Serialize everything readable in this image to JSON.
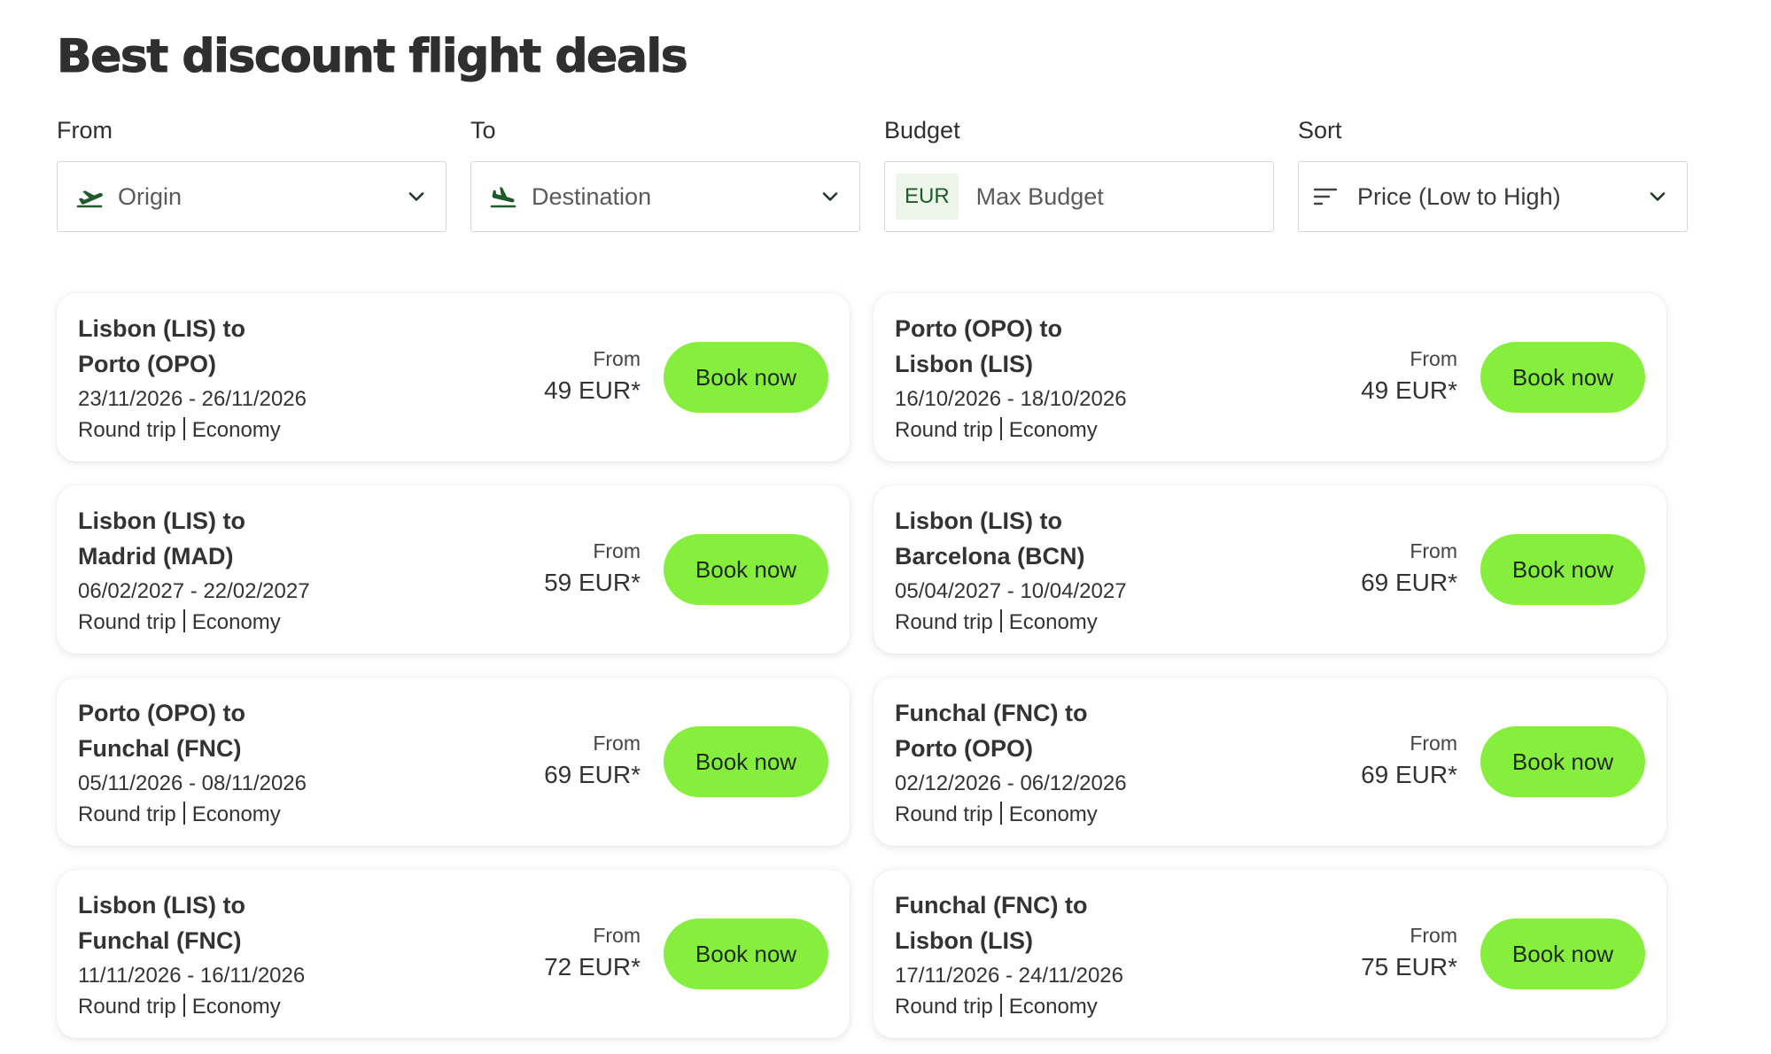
{
  "page": {
    "title": "Best discount flight deals"
  },
  "filters": {
    "from": {
      "label": "From",
      "placeholder": "Origin",
      "icon": "plane-takeoff-icon"
    },
    "to": {
      "label": "To",
      "placeholder": "Destination",
      "icon": "plane-landing-icon"
    },
    "budget": {
      "label": "Budget",
      "currency": "EUR",
      "placeholder": "Max Budget"
    },
    "sort": {
      "label": "Sort",
      "value": "Price (Low to High)",
      "icon": "sort-lines-icon"
    }
  },
  "colors": {
    "accent_green": "#86ef3e",
    "icon_dark_green": "#1e5a2a"
  },
  "deals": [
    {
      "route_line1": "Lisbon (LIS) to",
      "route_line2": "Porto (OPO)",
      "dates": "23/11/2026 - 26/11/2026",
      "trip_type": "Round trip",
      "cabin": "Economy",
      "price_from": "From",
      "price": "49 EUR*",
      "button": "Book now"
    },
    {
      "route_line1": "Porto (OPO) to",
      "route_line2": "Lisbon (LIS)",
      "dates": "16/10/2026 - 18/10/2026",
      "trip_type": "Round trip",
      "cabin": "Economy",
      "price_from": "From",
      "price": "49 EUR*",
      "button": "Book now"
    },
    {
      "route_line1": "Lisbon (LIS) to",
      "route_line2": "Madrid (MAD)",
      "dates": "06/02/2027 - 22/02/2027",
      "trip_type": "Round trip",
      "cabin": "Economy",
      "price_from": "From",
      "price": "59 EUR*",
      "button": "Book now"
    },
    {
      "route_line1": "Lisbon (LIS) to",
      "route_line2": "Barcelona (BCN)",
      "dates": "05/04/2027 - 10/04/2027",
      "trip_type": "Round trip",
      "cabin": "Economy",
      "price_from": "From",
      "price": "69 EUR*",
      "button": "Book now"
    },
    {
      "route_line1": "Porto (OPO) to",
      "route_line2": "Funchal (FNC)",
      "dates": "05/11/2026 - 08/11/2026",
      "trip_type": "Round trip",
      "cabin": "Economy",
      "price_from": "From",
      "price": "69 EUR*",
      "button": "Book now"
    },
    {
      "route_line1": "Funchal (FNC) to",
      "route_line2": "Porto (OPO)",
      "dates": "02/12/2026 - 06/12/2026",
      "trip_type": "Round trip",
      "cabin": "Economy",
      "price_from": "From",
      "price": "69 EUR*",
      "button": "Book now"
    },
    {
      "route_line1": "Lisbon (LIS) to",
      "route_line2": "Funchal (FNC)",
      "dates": "11/11/2026 - 16/11/2026",
      "trip_type": "Round trip",
      "cabin": "Economy",
      "price_from": "From",
      "price": "72 EUR*",
      "button": "Book now"
    },
    {
      "route_line1": "Funchal (FNC) to",
      "route_line2": "Lisbon (LIS)",
      "dates": "17/11/2026 - 24/11/2026",
      "trip_type": "Round trip",
      "cabin": "Economy",
      "price_from": "From",
      "price": "75 EUR*",
      "button": "Book now"
    }
  ]
}
